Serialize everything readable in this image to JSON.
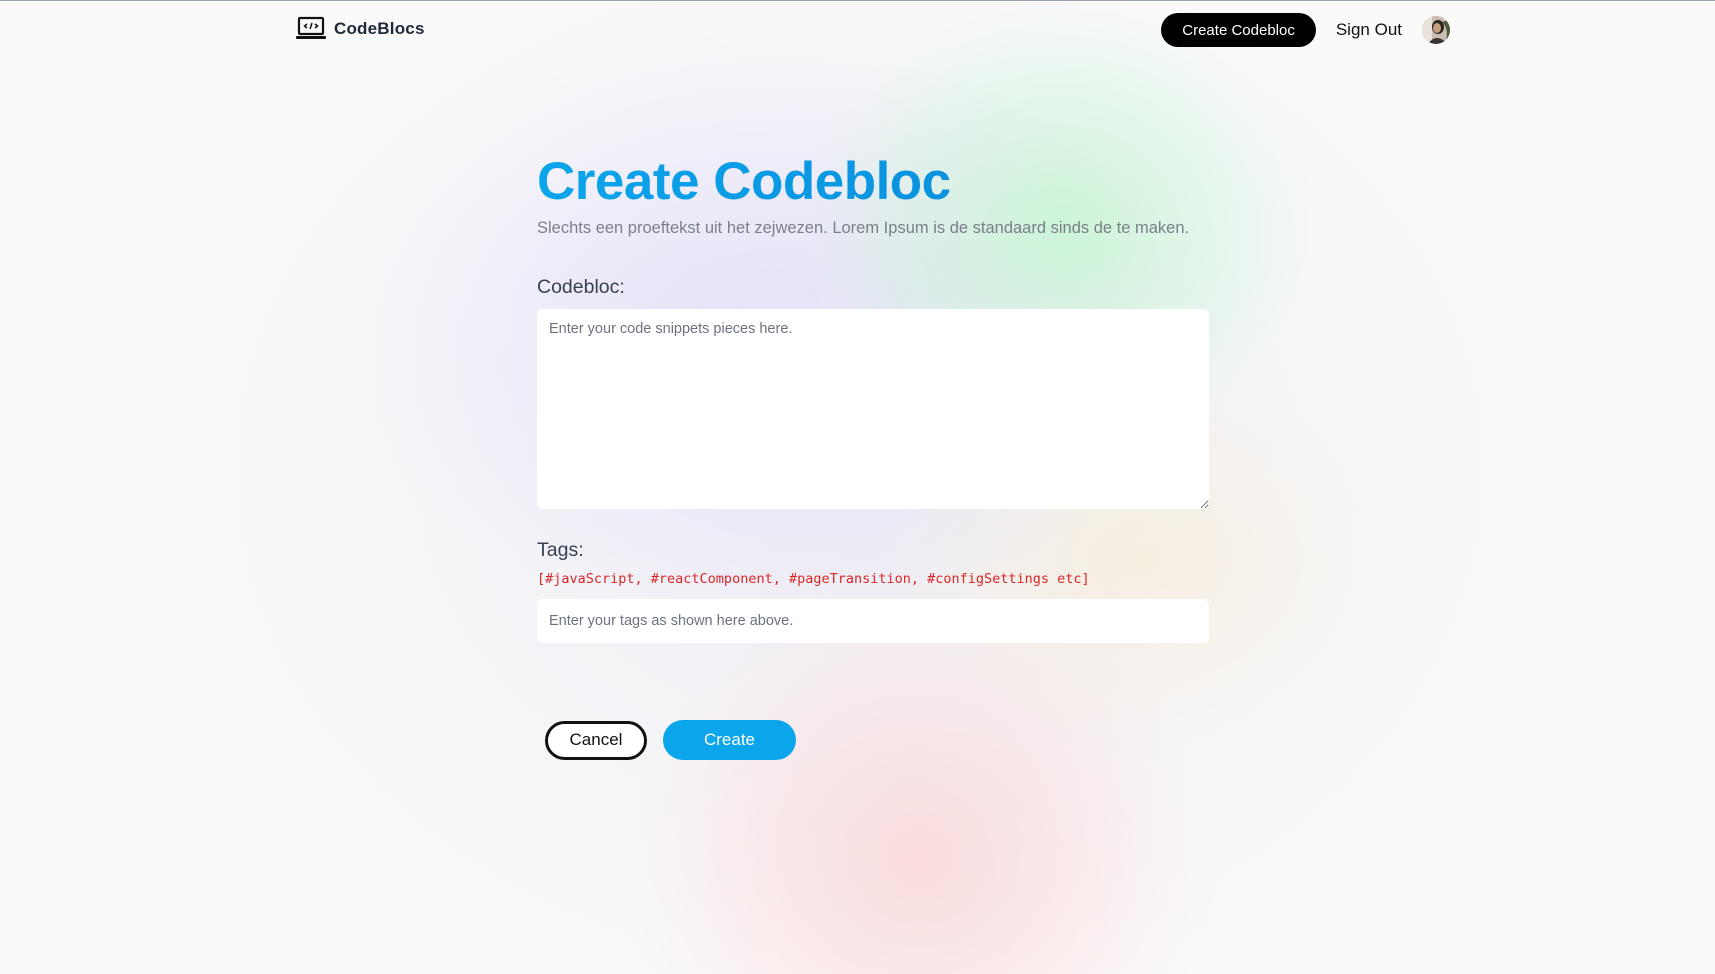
{
  "header": {
    "brand_name": "CodeBlocs",
    "create_button_label": "Create Codebloc",
    "signout_label": "Sign Out"
  },
  "icons": {
    "brand": "laptop-code-icon",
    "avatar": "user-avatar"
  },
  "page": {
    "title": "Create Codebloc",
    "subtitle": "Slechts een proeftekst uit het zejwezen. Lorem Ipsum is de standaard sinds de te maken."
  },
  "form": {
    "codebloc_label": "Codebloc:",
    "codebloc_placeholder": "Enter your code snippets pieces here.",
    "codebloc_value": "",
    "tags_label": "Tags:",
    "tags_hint": "[#javaScript, #reactComponent, #pageTransition, #configSettings etc]",
    "tags_placeholder": "Enter your tags as shown here above.",
    "tags_value": ""
  },
  "actions": {
    "cancel_label": "Cancel",
    "create_label": "Create"
  },
  "colors": {
    "accent": "#0ba5ec",
    "hint_red": "#dc2626",
    "nav_button_bg": "#000000"
  }
}
